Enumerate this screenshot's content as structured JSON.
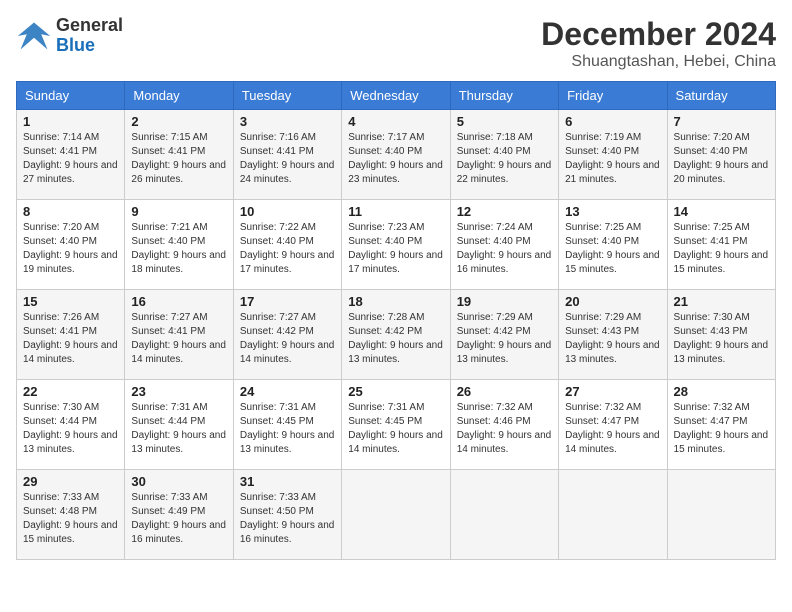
{
  "header": {
    "logo_text_general": "General",
    "logo_text_blue": "Blue",
    "month_title": "December 2024",
    "location": "Shuangtashan, Hebei, China"
  },
  "weekdays": [
    "Sunday",
    "Monday",
    "Tuesday",
    "Wednesday",
    "Thursday",
    "Friday",
    "Saturday"
  ],
  "weeks": [
    [
      {
        "day": "1",
        "sunrise": "Sunrise: 7:14 AM",
        "sunset": "Sunset: 4:41 PM",
        "daylight": "Daylight: 9 hours and 27 minutes."
      },
      {
        "day": "2",
        "sunrise": "Sunrise: 7:15 AM",
        "sunset": "Sunset: 4:41 PM",
        "daylight": "Daylight: 9 hours and 26 minutes."
      },
      {
        "day": "3",
        "sunrise": "Sunrise: 7:16 AM",
        "sunset": "Sunset: 4:41 PM",
        "daylight": "Daylight: 9 hours and 24 minutes."
      },
      {
        "day": "4",
        "sunrise": "Sunrise: 7:17 AM",
        "sunset": "Sunset: 4:40 PM",
        "daylight": "Daylight: 9 hours and 23 minutes."
      },
      {
        "day": "5",
        "sunrise": "Sunrise: 7:18 AM",
        "sunset": "Sunset: 4:40 PM",
        "daylight": "Daylight: 9 hours and 22 minutes."
      },
      {
        "day": "6",
        "sunrise": "Sunrise: 7:19 AM",
        "sunset": "Sunset: 4:40 PM",
        "daylight": "Daylight: 9 hours and 21 minutes."
      },
      {
        "day": "7",
        "sunrise": "Sunrise: 7:20 AM",
        "sunset": "Sunset: 4:40 PM",
        "daylight": "Daylight: 9 hours and 20 minutes."
      }
    ],
    [
      {
        "day": "8",
        "sunrise": "Sunrise: 7:20 AM",
        "sunset": "Sunset: 4:40 PM",
        "daylight": "Daylight: 9 hours and 19 minutes."
      },
      {
        "day": "9",
        "sunrise": "Sunrise: 7:21 AM",
        "sunset": "Sunset: 4:40 PM",
        "daylight": "Daylight: 9 hours and 18 minutes."
      },
      {
        "day": "10",
        "sunrise": "Sunrise: 7:22 AM",
        "sunset": "Sunset: 4:40 PM",
        "daylight": "Daylight: 9 hours and 17 minutes."
      },
      {
        "day": "11",
        "sunrise": "Sunrise: 7:23 AM",
        "sunset": "Sunset: 4:40 PM",
        "daylight": "Daylight: 9 hours and 17 minutes."
      },
      {
        "day": "12",
        "sunrise": "Sunrise: 7:24 AM",
        "sunset": "Sunset: 4:40 PM",
        "daylight": "Daylight: 9 hours and 16 minutes."
      },
      {
        "day": "13",
        "sunrise": "Sunrise: 7:25 AM",
        "sunset": "Sunset: 4:40 PM",
        "daylight": "Daylight: 9 hours and 15 minutes."
      },
      {
        "day": "14",
        "sunrise": "Sunrise: 7:25 AM",
        "sunset": "Sunset: 4:41 PM",
        "daylight": "Daylight: 9 hours and 15 minutes."
      }
    ],
    [
      {
        "day": "15",
        "sunrise": "Sunrise: 7:26 AM",
        "sunset": "Sunset: 4:41 PM",
        "daylight": "Daylight: 9 hours and 14 minutes."
      },
      {
        "day": "16",
        "sunrise": "Sunrise: 7:27 AM",
        "sunset": "Sunset: 4:41 PM",
        "daylight": "Daylight: 9 hours and 14 minutes."
      },
      {
        "day": "17",
        "sunrise": "Sunrise: 7:27 AM",
        "sunset": "Sunset: 4:42 PM",
        "daylight": "Daylight: 9 hours and 14 minutes."
      },
      {
        "day": "18",
        "sunrise": "Sunrise: 7:28 AM",
        "sunset": "Sunset: 4:42 PM",
        "daylight": "Daylight: 9 hours and 13 minutes."
      },
      {
        "day": "19",
        "sunrise": "Sunrise: 7:29 AM",
        "sunset": "Sunset: 4:42 PM",
        "daylight": "Daylight: 9 hours and 13 minutes."
      },
      {
        "day": "20",
        "sunrise": "Sunrise: 7:29 AM",
        "sunset": "Sunset: 4:43 PM",
        "daylight": "Daylight: 9 hours and 13 minutes."
      },
      {
        "day": "21",
        "sunrise": "Sunrise: 7:30 AM",
        "sunset": "Sunset: 4:43 PM",
        "daylight": "Daylight: 9 hours and 13 minutes."
      }
    ],
    [
      {
        "day": "22",
        "sunrise": "Sunrise: 7:30 AM",
        "sunset": "Sunset: 4:44 PM",
        "daylight": "Daylight: 9 hours and 13 minutes."
      },
      {
        "day": "23",
        "sunrise": "Sunrise: 7:31 AM",
        "sunset": "Sunset: 4:44 PM",
        "daylight": "Daylight: 9 hours and 13 minutes."
      },
      {
        "day": "24",
        "sunrise": "Sunrise: 7:31 AM",
        "sunset": "Sunset: 4:45 PM",
        "daylight": "Daylight: 9 hours and 13 minutes."
      },
      {
        "day": "25",
        "sunrise": "Sunrise: 7:31 AM",
        "sunset": "Sunset: 4:45 PM",
        "daylight": "Daylight: 9 hours and 14 minutes."
      },
      {
        "day": "26",
        "sunrise": "Sunrise: 7:32 AM",
        "sunset": "Sunset: 4:46 PM",
        "daylight": "Daylight: 9 hours and 14 minutes."
      },
      {
        "day": "27",
        "sunrise": "Sunrise: 7:32 AM",
        "sunset": "Sunset: 4:47 PM",
        "daylight": "Daylight: 9 hours and 14 minutes."
      },
      {
        "day": "28",
        "sunrise": "Sunrise: 7:32 AM",
        "sunset": "Sunset: 4:47 PM",
        "daylight": "Daylight: 9 hours and 15 minutes."
      }
    ],
    [
      {
        "day": "29",
        "sunrise": "Sunrise: 7:33 AM",
        "sunset": "Sunset: 4:48 PM",
        "daylight": "Daylight: 9 hours and 15 minutes."
      },
      {
        "day": "30",
        "sunrise": "Sunrise: 7:33 AM",
        "sunset": "Sunset: 4:49 PM",
        "daylight": "Daylight: 9 hours and 16 minutes."
      },
      {
        "day": "31",
        "sunrise": "Sunrise: 7:33 AM",
        "sunset": "Sunset: 4:50 PM",
        "daylight": "Daylight: 9 hours and 16 minutes."
      },
      null,
      null,
      null,
      null
    ]
  ]
}
